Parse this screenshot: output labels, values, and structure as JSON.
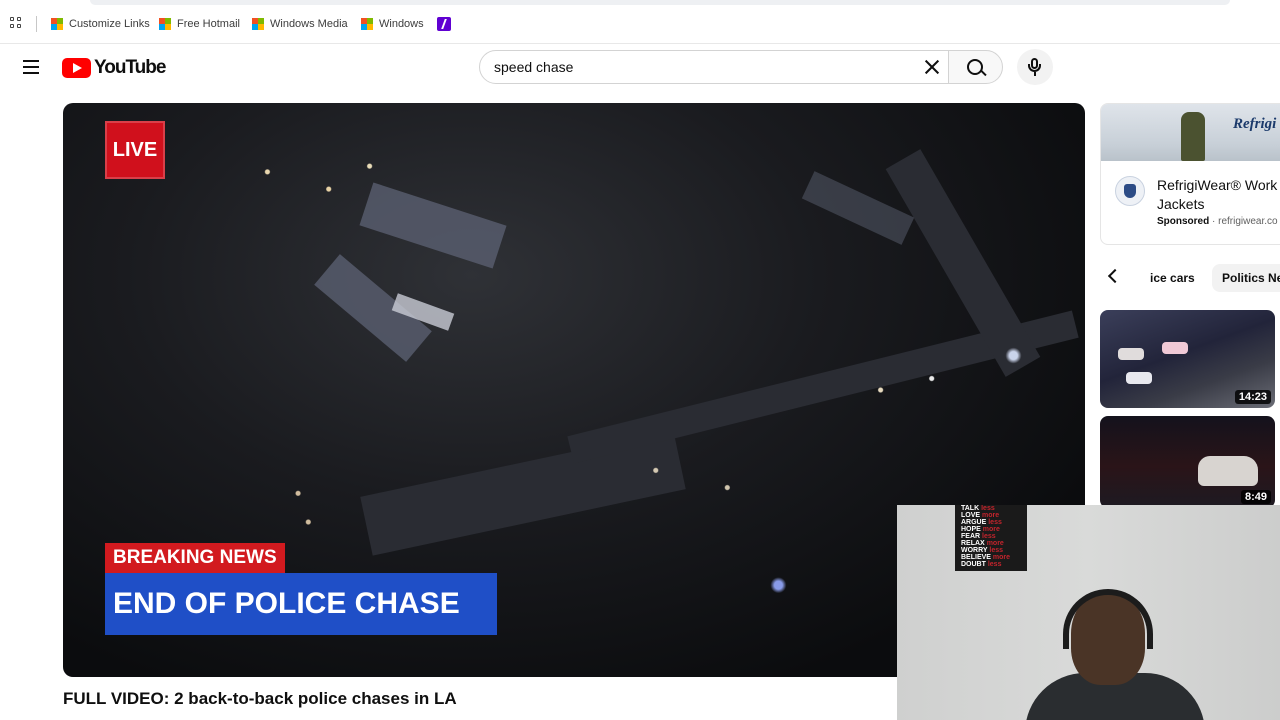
{
  "bookmarks": {
    "items": [
      {
        "label": "Customize Links",
        "icon": "microsoft-logo-icon"
      },
      {
        "label": "Free Hotmail",
        "icon": "microsoft-logo-icon"
      },
      {
        "label": "Windows Media",
        "icon": "microsoft-logo-icon"
      },
      {
        "label": "Windows",
        "icon": "microsoft-logo-icon"
      }
    ],
    "extra_icon": "yahoo-icon"
  },
  "header": {
    "logo_text": "YouTube",
    "search_value": "speed chase"
  },
  "player": {
    "live_label": "LIVE",
    "breaking_label": "BREAKING NEWS",
    "headline": "END OF POLICE CHASE"
  },
  "video": {
    "title": "FULL VIDEO: 2 back-to-back police chases in LA"
  },
  "ad": {
    "brand_banner": "Refrigi",
    "title": "RefrigiWear® Work Jackets",
    "sponsored_label": "Sponsored",
    "domain": "refrigiwear.co"
  },
  "chips": [
    {
      "label": "ice cars"
    },
    {
      "label": "Politics Ne"
    }
  ],
  "related": [
    {
      "duration": "14:23"
    },
    {
      "duration": "8:49"
    }
  ],
  "webcam": {
    "poster_lines": [
      {
        "a": "TALK",
        "b": "less"
      },
      {
        "a": "LOVE",
        "b": "more"
      },
      {
        "a": "ARGUE",
        "b": "less"
      },
      {
        "a": "HOPE",
        "b": "more"
      },
      {
        "a": "FEAR",
        "b": "less"
      },
      {
        "a": "RELAX",
        "b": "more"
      },
      {
        "a": "WORRY",
        "b": "less"
      },
      {
        "a": "BELIEVE",
        "b": "more"
      },
      {
        "a": "DOUBT",
        "b": "less"
      }
    ]
  },
  "colors": {
    "youtube_red": "#ff0000",
    "breaking_red": "#d21a1f",
    "headline_blue": "#1f4fc7",
    "live_red": "#d0101c"
  }
}
